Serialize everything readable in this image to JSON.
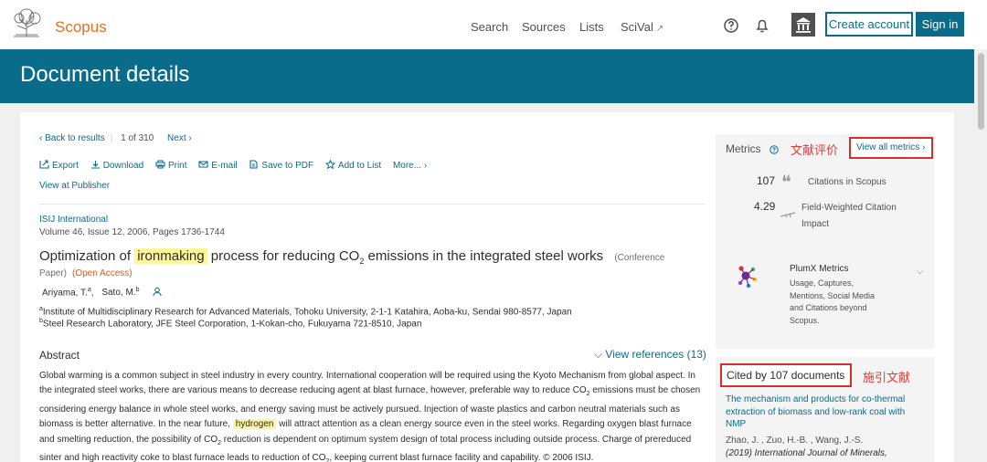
{
  "header": {
    "brand": "Scopus",
    "nav": [
      "Search",
      "Sources",
      "Lists",
      "SciVal"
    ],
    "scival_arrow": "↗",
    "create_account": "Create account",
    "sign_in": "Sign in"
  },
  "banner": {
    "title": "Document details"
  },
  "pager": {
    "back": "‹ Back to results",
    "position": "1",
    "of": "of",
    "total": "310",
    "next": "Next ›"
  },
  "actions": [
    "Export",
    "Download",
    "Print",
    "E-mail",
    "Save to PDF",
    "Add to List",
    "More... ›"
  ],
  "view_publisher": "View at Publisher",
  "doc": {
    "journal": "ISIJ International",
    "volume": "Volume 46, Issue 12, 2006, Pages 1736-1744",
    "title_pre": "Optimization of",
    "title_hl": "ironmaking",
    "title_mid": "process for reducing CO",
    "title_sub": "2",
    "title_post": "emissions in the integrated steel works",
    "doc_type_1": "(Conference",
    "doc_type_2": "Paper)",
    "open_access": "(Open Access)",
    "author_1": "Ariyama, T.",
    "author_1_sup": "a",
    "author_2": "Sato, M.",
    "author_2_sup": "b",
    "aff_a_sup": "a",
    "aff_a": "Institute of Multidisciplinary Research for Advanced Materials, Tohoku University, 2-1-1 Katahira, Aoba-ku, Sendai 980-8577, Japan",
    "aff_b_sup": "b",
    "aff_b": "Steel Research Laboratory, JFE Steel Corporation, 1-Kokan-cho, Fukuyama 721-8510, Japan"
  },
  "abstract": {
    "heading": "Abstract",
    "view_refs": "⌵ View references (13)",
    "p1": "Global warming is a common subject in steel industry in every country. International cooperation will be required using the Kyoto Mechanism from global aspect. In the integrated steel works, there are various means to decrease reducing agent at blast furnace, however, preferable way to reduce CO",
    "p1_sub": "2",
    "p2": "emissions must be chosen considering energy balance in whole steel works, and energy saving must be actively pursued. Injection of waste plastics and carbon neutral materials such as biomass is better alternative. In the near future,",
    "p2_hl": "hydrogen",
    "p3": "will attract attention as a clean energy source even in the steel works. Regarding oxygen blast furnace and smelting reduction, the possibility of CO",
    "p3_sub": "2",
    "p4": "reduction is dependent on optimum system design of total process including outside process. Charge of prereduced sinter and high reactivity coke to blast furnace leads to reduction of CO",
    "p4_sub": "2",
    "p5": ", keeping current blast furnace facility and capability. © 2006 ISIJ."
  },
  "metrics": {
    "heading": "Metrics",
    "cn_label": "文献评价",
    "view_all": "View all metrics ›",
    "citations_num": "107",
    "citations_lbl": "Citations in Scopus",
    "fwci_num": "4.29",
    "fwci_lbl_1": "Field-Weighted Citation",
    "fwci_lbl_2": "Impact",
    "plumx_title": "PlumX Metrics",
    "plumx_desc": "Usage, Captures, Mentions, Social Media and Citations beyond Scopus."
  },
  "cited_by": {
    "heading": "Cited by 107 documents",
    "cn_label": "施引文献",
    "item_title": "The mechanism and products for co-thermal extraction of biomass and low-rank coal with NMP",
    "item_authors": "Zhao, J. , Zuo, H.-B. , Wang, J.-S.",
    "item_source": "(2019) International Journal of Minerals,"
  }
}
